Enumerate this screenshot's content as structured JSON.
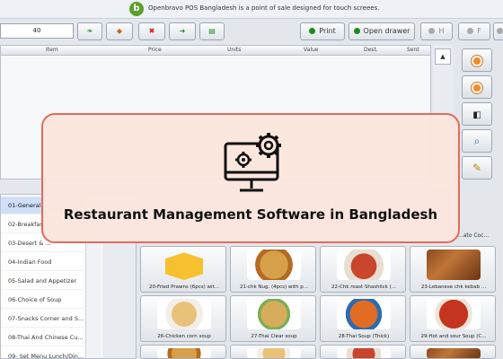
{
  "header": {
    "logo_letter": "b",
    "tagline": "Openbravo POS Bangladesh is a point of sale designed for touch screees."
  },
  "toolbar": {
    "qty_value": "40",
    "print_label": "Print",
    "open_drawer_label": "Open drawer",
    "button_h_label": "H",
    "button_f_label": "F"
  },
  "ticket": {
    "columns": [
      "Item",
      "Price",
      "Units",
      "Value",
      "Dest.",
      "Sent"
    ],
    "scroll_up": "▲"
  },
  "categories": [
    "01-General",
    "02-Breakfast",
    "03-Desert & ...",
    "04-Indian Food",
    "05-Salad and Appetizer",
    "06-Choice of Soup",
    "07-Snacks Corner and S...",
    "08-Thai And Chinese Cu...",
    "09- Set Menu Lunch/Din..."
  ],
  "products": [
    {
      "label": "20-Fried Prawns (6pcs) wit...",
      "icon": "box"
    },
    {
      "label": "21-chk Nug. (4pcs) with p...",
      "icon": "noodle"
    },
    {
      "label": "22-Chk roast Shashlick (...",
      "icon": "shashlik"
    },
    {
      "label": "23-Lebanese chk kebab ...",
      "icon": "kebab"
    },
    {
      "label": "26-Chicken corn soup",
      "icon": "soup1"
    },
    {
      "label": "27-Thai Clear soup",
      "icon": "soup2"
    },
    {
      "label": "28-Thai Soup (Thick)",
      "icon": "soup3"
    },
    {
      "label": "29-Hot and sour Soup (C...",
      "icon": "soup4"
    }
  ],
  "partial_product_label": "...ato Coc...",
  "overlay": {
    "title": "Restaurant Management Software in Bangladesh",
    "icon": "computer-settings-icon"
  },
  "colors": {
    "accent_green": "#1f8a1f",
    "orange": "#f28a2c",
    "overlay_border": "#e46a5d",
    "overlay_bg": "#fce6de"
  }
}
